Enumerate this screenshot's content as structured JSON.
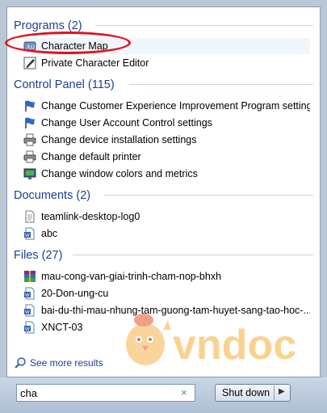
{
  "groups": {
    "programs": {
      "label": "Programs (2)"
    },
    "control_panel": {
      "label": "Control Panel (115)"
    },
    "documents": {
      "label": "Documents (2)"
    },
    "files": {
      "label": "Files (27)"
    }
  },
  "programs": [
    {
      "label": "Character Map",
      "icon": "character-map-icon"
    },
    {
      "label": "Private Character Editor",
      "icon": "private-character-editor-icon"
    }
  ],
  "control_panel": [
    {
      "label": "Change Customer Experience Improvement Program settings",
      "icon": "action-center-flag-icon"
    },
    {
      "label": "Change User Account Control settings",
      "icon": "action-center-flag-icon"
    },
    {
      "label": "Change device installation settings",
      "icon": "printer-icon"
    },
    {
      "label": "Change default printer",
      "icon": "printer-icon"
    },
    {
      "label": "Change window colors and metrics",
      "icon": "display-icon"
    }
  ],
  "documents": [
    {
      "label": "teamlink-desktop-log0",
      "icon": "text-file-icon"
    },
    {
      "label": "abc",
      "icon": "word-document-icon"
    }
  ],
  "files": [
    {
      "label": "mau-cong-van-giai-trinh-cham-nop-bhxh",
      "icon": "winrar-archive-icon"
    },
    {
      "label": "20-Don-ung-cu",
      "icon": "word-document-icon"
    },
    {
      "label": "bai-du-thi-mau-nhung-tam-guong-tam-huyet-sang-tao-hoc-...",
      "icon": "word-document-icon"
    },
    {
      "label": "XNCT-03",
      "icon": "word-document-icon"
    }
  ],
  "see_more": {
    "label": "See more results",
    "icon": "magnifier-icon"
  },
  "search": {
    "value": "cha",
    "clear_icon": "clear-x-icon"
  },
  "shutdown": {
    "label": "Shut down",
    "arrow_icon": "chevron-right-icon"
  },
  "watermark": {
    "text": "vndoc"
  },
  "colors": {
    "header_blue": "#1e3f8f",
    "annotation_red": "#e0131f",
    "watermark_orange": "#f6a623"
  }
}
